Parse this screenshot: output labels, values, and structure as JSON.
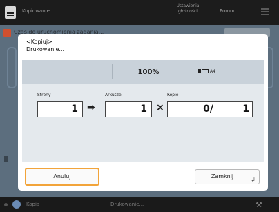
{
  "topbar": {
    "title": "Kopiowanie",
    "settings_label": "Ustawienia głośności",
    "help_label": "Pomoc"
  },
  "background": {
    "status_text": "Czas do uruchomienia zadania..."
  },
  "dialog": {
    "title_line1": "<Kopiuj>",
    "title_line2": "Drukowanie...",
    "zoom": "100%",
    "paper_size": "A4",
    "pages_label": "Strony",
    "pages_value": "1",
    "sheets_label": "Arkusze",
    "sheets_value": "1",
    "copies_label": "Kopie",
    "copies_done": "0/",
    "copies_total": "1",
    "arrow_symbol": "➡",
    "multiply_symbol": "×",
    "cancel_label": "Anuluj",
    "close_label": "Zamknij",
    "return_symbol": "↲"
  },
  "bottombar": {
    "left_label": "Kopia",
    "center_label": "Drukowanie...",
    "tool_symbol": "⚒"
  },
  "colors": {
    "focus_outline": "#f2a43a",
    "warning": "#d05030",
    "overlay": "#5c6e7e"
  }
}
